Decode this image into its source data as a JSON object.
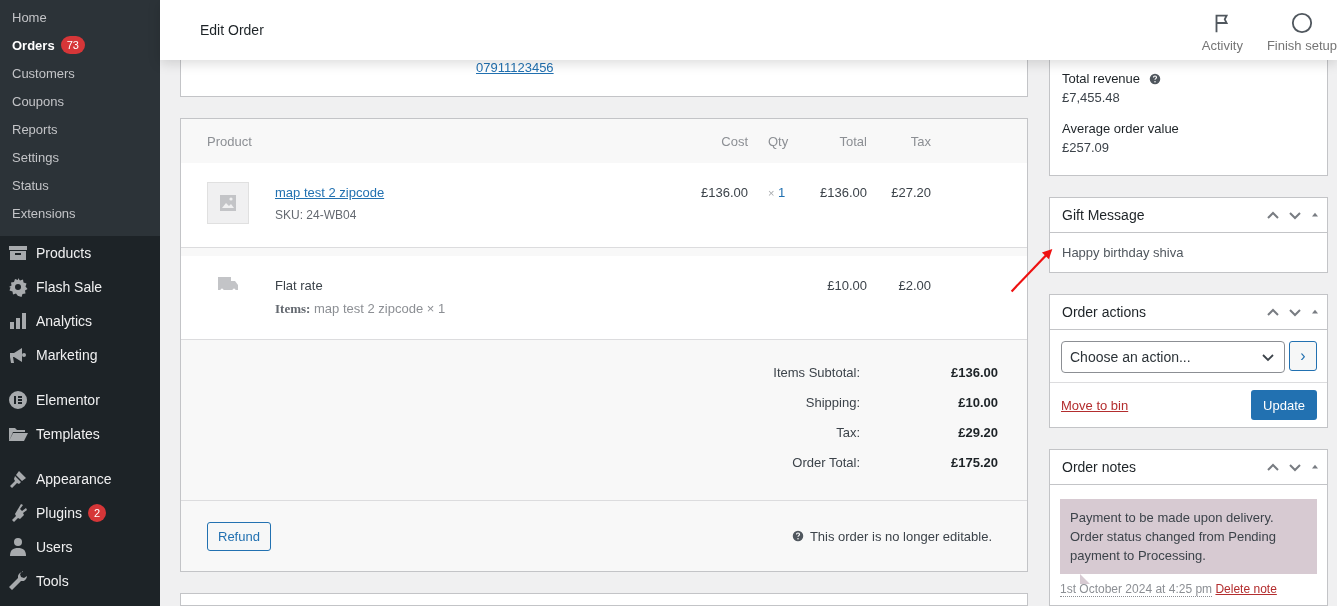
{
  "sidebar": {
    "submenu": [
      {
        "label": "Home",
        "selected": false
      },
      {
        "label": "Orders",
        "selected": true,
        "badge": "73"
      },
      {
        "label": "Customers",
        "selected": false
      },
      {
        "label": "Coupons",
        "selected": false
      },
      {
        "label": "Reports",
        "selected": false
      },
      {
        "label": "Settings",
        "selected": false
      },
      {
        "label": "Status",
        "selected": false
      },
      {
        "label": "Extensions",
        "selected": false
      }
    ],
    "menu_groups": [
      [
        {
          "label": "Products"
        },
        {
          "label": "Flash Sale"
        },
        {
          "label": "Analytics"
        },
        {
          "label": "Marketing"
        }
      ],
      [
        {
          "label": "Elementor"
        },
        {
          "label": "Templates"
        }
      ],
      [
        {
          "label": "Appearance"
        },
        {
          "label": "Plugins",
          "badge": "2"
        },
        {
          "label": "Users"
        },
        {
          "label": "Tools"
        }
      ]
    ]
  },
  "header": {
    "title": "Edit Order",
    "actions": [
      {
        "label": "Activity"
      },
      {
        "label": "Finish setup"
      }
    ]
  },
  "contact": {
    "phone": "07911123456"
  },
  "items_table": {
    "columns": [
      "Product",
      "Cost",
      "Qty",
      "Total",
      "Tax"
    ],
    "rows": [
      {
        "name": "map test 2 zipcode",
        "sku": "SKU: 24-WB04",
        "cost": "£136.00",
        "qty_sign": "×",
        "qty": "1",
        "total": "£136.00",
        "tax": "£27.20"
      }
    ],
    "shipping": [
      {
        "name": "Flat rate",
        "items_label": "Items:",
        "items": "map test 2 zipcode × 1",
        "total": "£10.00",
        "tax": "£2.00"
      }
    ],
    "totals": [
      {
        "label": "Items Subtotal:",
        "value": "£136.00"
      },
      {
        "label": "Shipping:",
        "value": "£10.00"
      },
      {
        "label": "Tax:",
        "value": "£29.20"
      },
      {
        "label": "Order Total:",
        "value": "£175.20"
      }
    ],
    "refund_button": "Refund",
    "notice": "This order is no longer editable."
  },
  "stats": [
    {
      "label": "Total revenue",
      "help": true,
      "value": "£7,455.48"
    },
    {
      "label": "Average order value",
      "help": false,
      "value": "£257.09"
    }
  ],
  "gift_message": {
    "title": "Gift Message",
    "text": "Happy birthday shiva"
  },
  "order_actions": {
    "title": "Order actions",
    "select": "Choose an action...",
    "go": "›",
    "trash": "Move to bin",
    "update": "Update"
  },
  "order_notes": {
    "title": "Order notes",
    "notes": [
      {
        "text": "Payment to be made upon delivery. Order status changed from Pending payment to Processing.",
        "date": "1st October 2024 at 4:25 pm",
        "delete": "Delete note"
      }
    ]
  }
}
